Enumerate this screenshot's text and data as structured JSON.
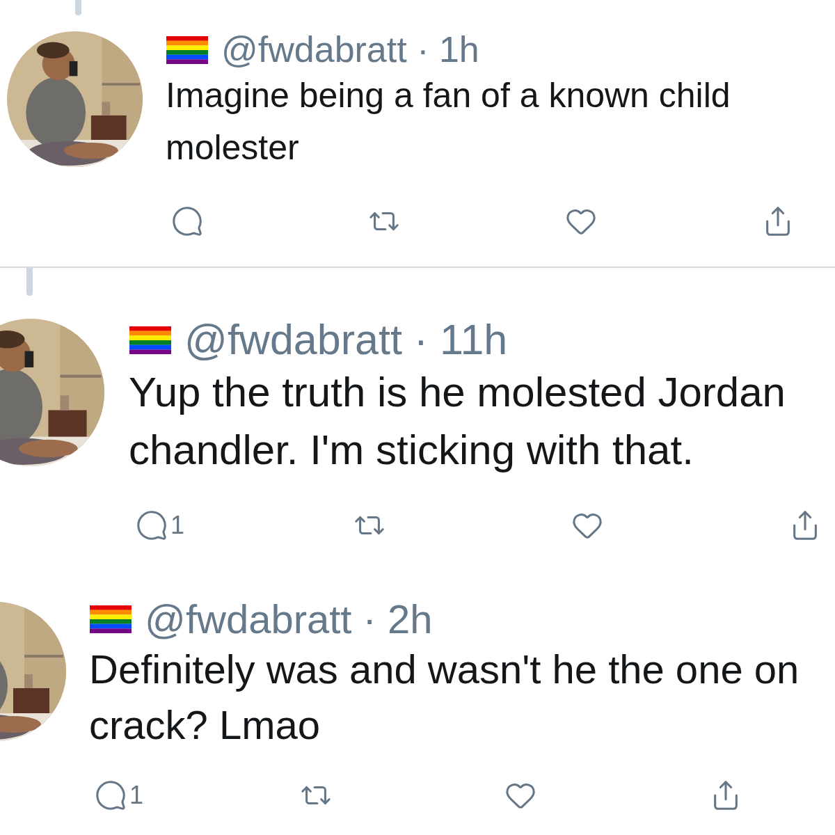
{
  "tweets": [
    {
      "meta": "@fwdabratt · 1h",
      "text": "Imagine being a fan of a known child molester",
      "thread_line_above": true,
      "divider_after": true
    },
    {
      "meta": "@fwdabratt · 11h",
      "text": "Yup the truth is he molested Jordan chandler. I'm sticking with that.",
      "reply_count": "1",
      "thread_line_above": true,
      "divider_after": false
    },
    {
      "meta": "@fwdabratt · 2h",
      "text": "Definitely was and wasn't he the one on crack? Lmao",
      "reply_count": "1",
      "thread_line_above": false,
      "divider_after": false
    }
  ]
}
